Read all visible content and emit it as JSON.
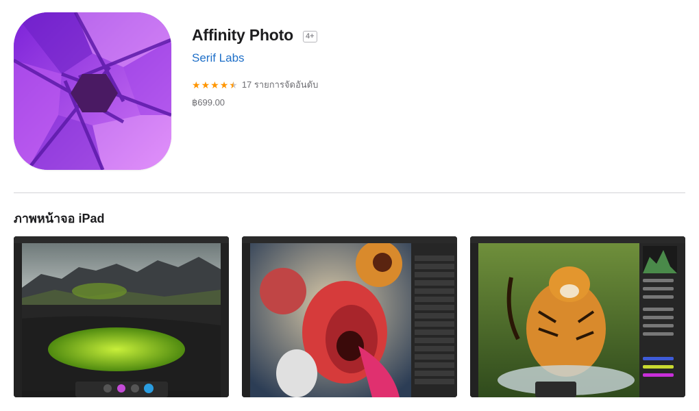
{
  "app": {
    "title": "Affinity Photo",
    "age_rating": "4+",
    "developer": "Serif Labs",
    "rating_value": 4.5,
    "rating_count_text": "17 รายการจัดอันดับ",
    "price": "฿699.00",
    "icon": "affinity-photo-aperture-icon",
    "icon_colors": {
      "primary": "#8a2be2",
      "secondary": "#c86cf5",
      "center": "#4a1a63"
    }
  },
  "screenshots_section": {
    "title": "ภาพหน้าจอ iPad",
    "items": [
      {
        "subject": "black sand dunes with green moss and mountains"
      },
      {
        "subject": "screaming face with lion and horse composite"
      },
      {
        "subject": "tiger running through water"
      }
    ]
  },
  "colors": {
    "link": "#1e6fc8",
    "star": "#ff9500",
    "divider": "#d2d2d7"
  }
}
